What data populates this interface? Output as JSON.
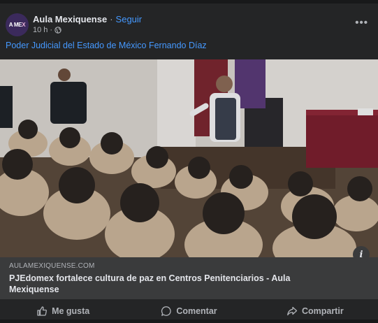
{
  "post": {
    "page_name": "Aula Mexiquense",
    "separator": "·",
    "follow_label": "Seguir",
    "time": "10 h",
    "meta_sep": "·",
    "avatar_text_1": "A ME",
    "avatar_text_2": "X",
    "caption": "Poder Judicial del Estado de México Fernando Díaz",
    "more_label": "•••"
  },
  "link": {
    "domain": "AULAMEXIQUENSE.COM",
    "title": "PJEdomex fortalece cultura de paz en Centros Penitenciarios - Aula Mexiquense",
    "info_label": "i"
  },
  "actions": {
    "like": "Me gusta",
    "comment": "Comentar",
    "share": "Compartir"
  },
  "icons": {
    "globe": "globe-icon",
    "more": "more-options-icon",
    "like": "thumbs-up-icon",
    "comment": "comment-bubble-icon",
    "share": "share-arrow-icon"
  },
  "colors": {
    "card_bg": "#242526",
    "link_bg": "#3a3b3c",
    "accent": "#4599ff",
    "text": "#e4e6eb",
    "muted": "#b0b3b8"
  }
}
